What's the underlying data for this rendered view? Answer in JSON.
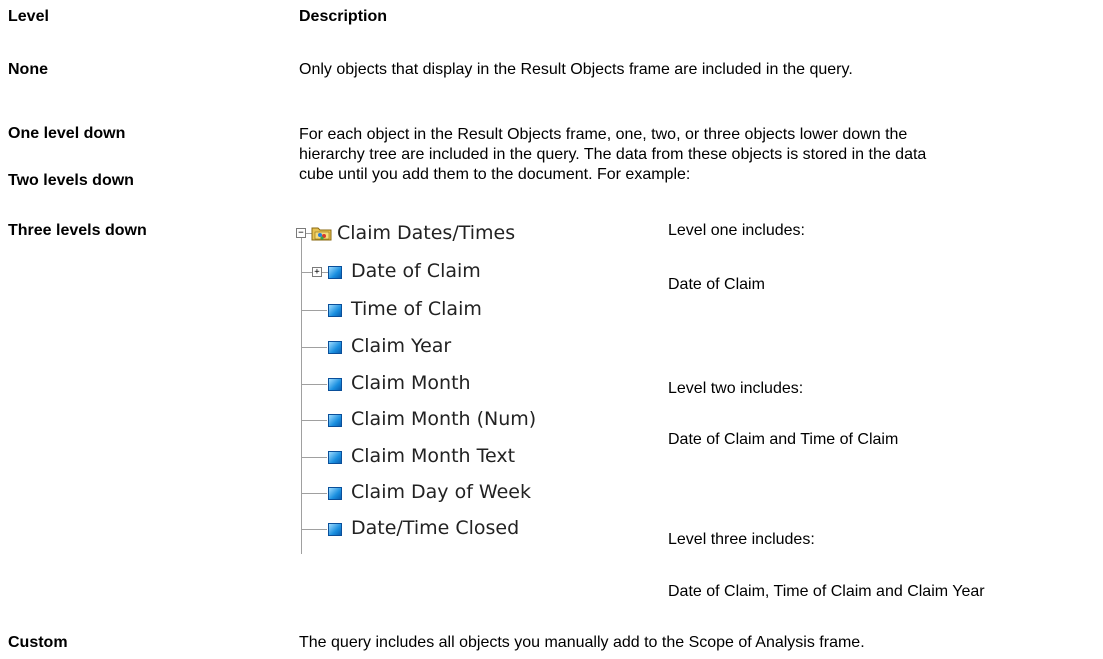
{
  "header": {
    "level": "Level",
    "description": "Description"
  },
  "rows": [
    {
      "level": "None",
      "description": "Only objects that display in the Result Objects frame are included in the query."
    },
    {
      "levels": [
        "One level down",
        "Two levels down",
        "Three levels down"
      ],
      "description_lines": [
        "For each object in the Result Objects frame, one, two, or three objects lower down the",
        "hierarchy tree are included in the query. The data from these objects is stored in the data",
        "cube until you add them to the document. For example:"
      ]
    },
    {
      "level": "Custom",
      "description": "The query includes all objects you manually add to the Scope of Analysis frame."
    }
  ],
  "tree": {
    "root": "Claim Dates/Times",
    "items": [
      "Date of Claim",
      "Time of Claim",
      "Claim Year",
      "Claim Month",
      "Claim Month (Num)",
      "Claim Month Text",
      "Claim Day of Week",
      "Date/Time Closed"
    ],
    "expander_collapsed": "+",
    "expander_expanded": "−"
  },
  "examples": [
    {
      "heading": "Level one includes:",
      "value": "Date of Claim"
    },
    {
      "heading": "Level two includes:",
      "value": "Date of Claim and Time of Claim"
    },
    {
      "heading": "Level three includes:",
      "value": "Date of Claim, Time of Claim and Claim Year"
    }
  ],
  "colors": {
    "cube_icon": "#1a8fe0",
    "folder": "#e8c252",
    "tree_lines": "#a0a0a0"
  }
}
